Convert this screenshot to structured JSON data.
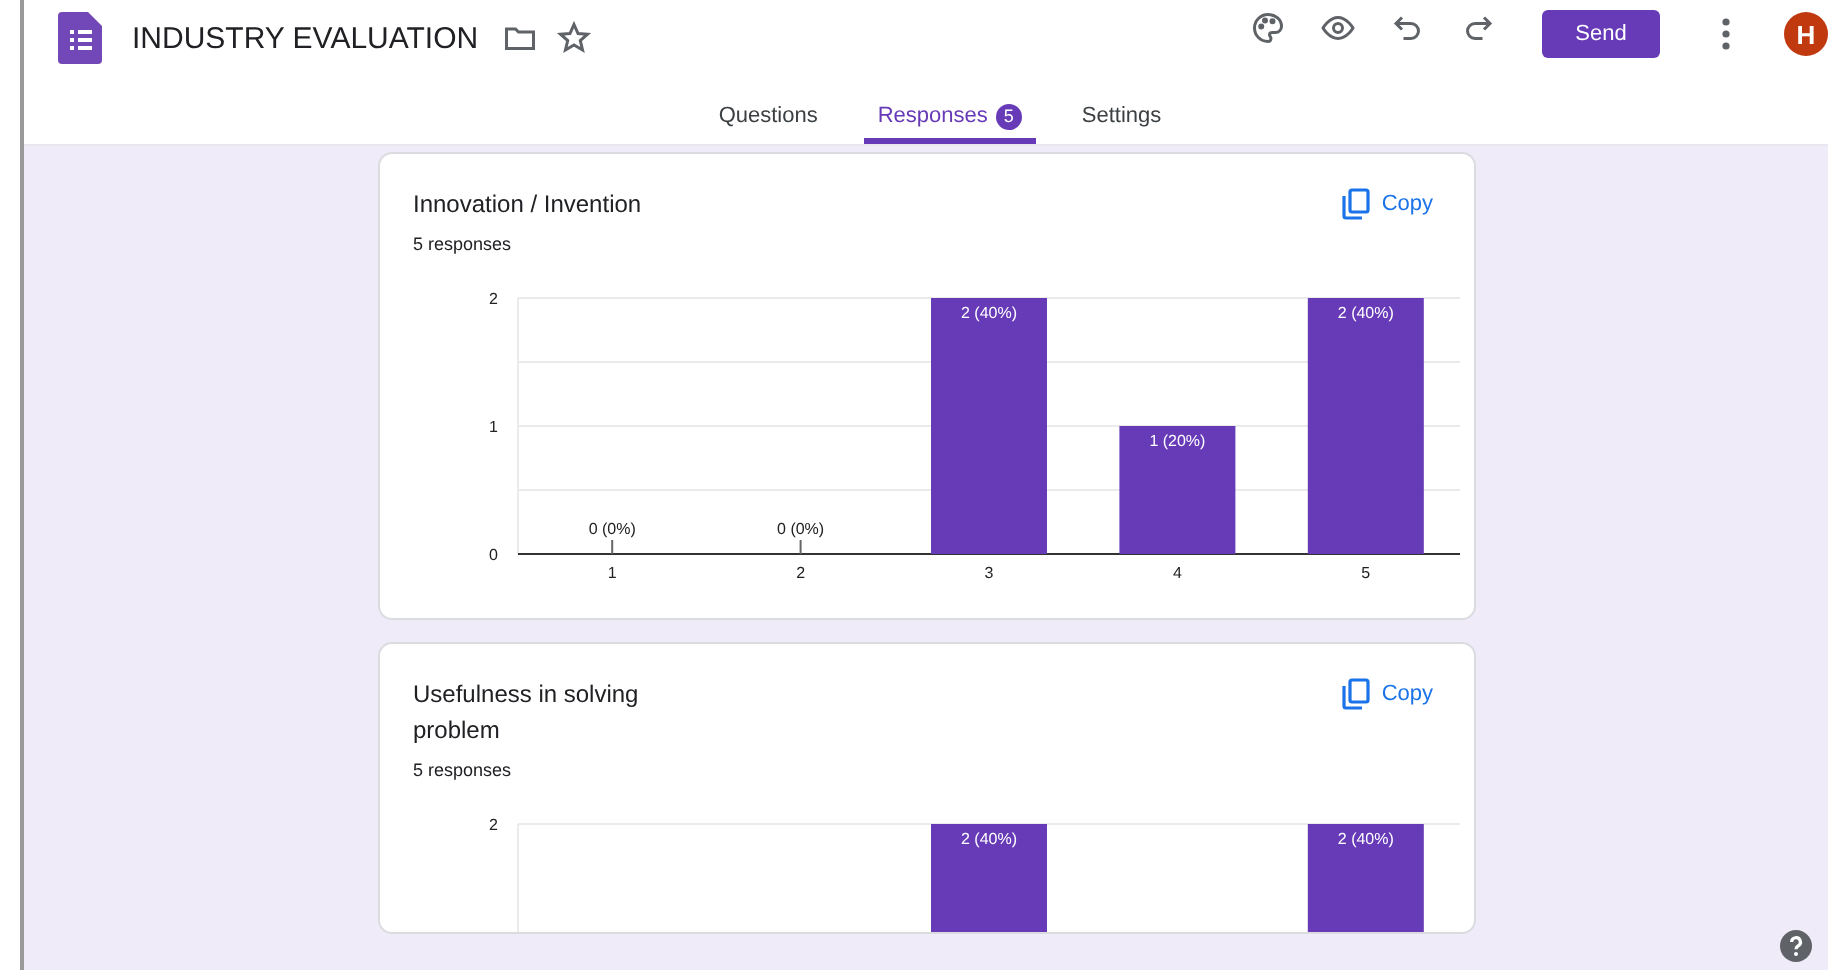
{
  "header": {
    "title": "INDUSTRY EVALUATION",
    "send_button": "Send",
    "avatar": "H"
  },
  "tabs": [
    {
      "label": "Questions",
      "selected": false
    },
    {
      "label": "Responses",
      "selected": true,
      "badge": "5"
    },
    {
      "label": "Settings",
      "selected": false
    }
  ],
  "questions": [
    {
      "title": "Innovation / Invention",
      "response_count": "5 responses",
      "copy_button": "Copy",
      "chart_data": {
        "type": "bar",
        "categories": [
          "1",
          "2",
          "3",
          "4",
          "5"
        ],
        "series": [
          {
            "color": "#673ab7",
            "values": [
              0,
              0,
              2,
              1,
              2
            ]
          }
        ],
        "ylim": [
          0,
          2
        ],
        "yticks": [
          0,
          1,
          2
        ],
        "value_labels": [
          "0 (0%)",
          "0 (0%)",
          "2 (40%)",
          "1 (20%)",
          "2 (40%)"
        ]
      }
    },
    {
      "title": "Usefulness in solving problem",
      "response_count": "5 responses",
      "copy_button": "Copy",
      "chart_data": {
        "type": "bar",
        "series": [
          {
            "color": "#673ab7",
            "values": [
              null,
              null,
              2,
              null,
              2
            ]
          }
        ],
        "ylim": [
          0,
          2
        ],
        "yticks": [
          2
        ],
        "value_labels": [
          null,
          null,
          "2 (40%)",
          null,
          "2 (40%)"
        ]
      }
    }
  ]
}
